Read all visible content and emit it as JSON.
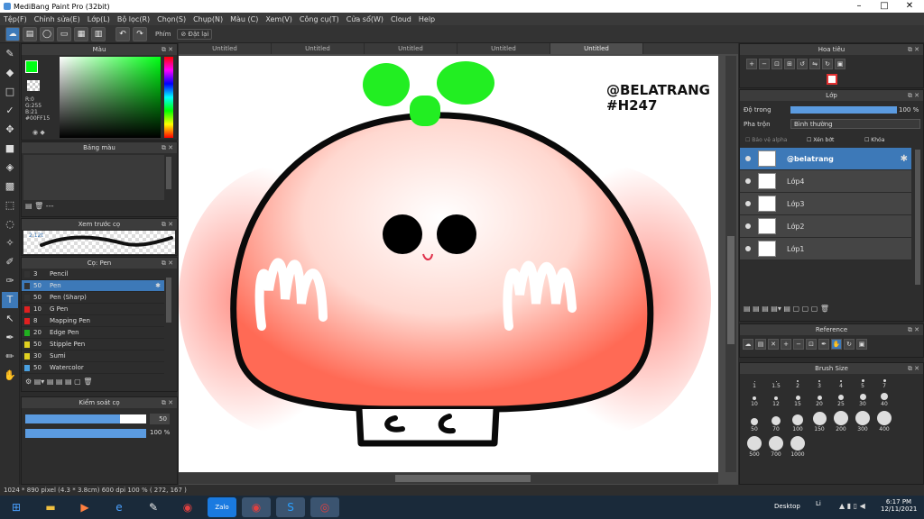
{
  "window": {
    "title": "MediBang Paint Pro (32bit)"
  },
  "menu": [
    "Tệp(F)",
    "Chỉnh sửa(E)",
    "Lớp(L)",
    "Bộ lọc(R)",
    "Chọn(S)",
    "Chụp(N)",
    "Màu (C)",
    "Xem(V)",
    "Công cụ(T)",
    "Cửa sổ(W)",
    "Cloud",
    "Help"
  ],
  "toolbar": {
    "key_label": "Phím",
    "reset_label": "Đặt lại"
  },
  "tabs": [
    "Untitled",
    "Untitled",
    "Untitled",
    "Untitled",
    "Untitled"
  ],
  "color_panel": {
    "title": "Màu",
    "r": "R:0",
    "g": "G:255",
    "b": "B:21",
    "hex": "#00FF15",
    "fg": "#00ff15"
  },
  "palette_panel": {
    "title": "Bảng màu"
  },
  "brush_preview": {
    "title": "Xem trước cọ",
    "size": "2.12t"
  },
  "brush_panel": {
    "title": "Cọ: Pen",
    "items": [
      {
        "size": "3",
        "name": "Pencil",
        "color": "#333333"
      },
      {
        "size": "50",
        "name": "Pen",
        "color": "#333333",
        "selected": true
      },
      {
        "size": "50",
        "name": "Pen (Sharp)",
        "color": "#333333"
      },
      {
        "size": "10",
        "name": "G Pen",
        "color": "#e02020"
      },
      {
        "size": "8",
        "name": "Mapping Pen",
        "color": "#e02020"
      },
      {
        "size": "20",
        "name": "Edge Pen",
        "color": "#20b020"
      },
      {
        "size": "50",
        "name": "Stipple Pen",
        "color": "#e0d020"
      },
      {
        "size": "30",
        "name": "Sumi",
        "color": "#e0d020"
      },
      {
        "size": "50",
        "name": "Watercolor",
        "color": "#4aa0e0"
      }
    ]
  },
  "brush_control": {
    "title": "Kiểm soát cọ",
    "size": "50",
    "opacity": "100 %",
    "size_level": 0.78,
    "opacity_level": 1.0
  },
  "navigator": {
    "title": "Hoa tiêu"
  },
  "layer_panel": {
    "title": "Lớp",
    "opacity_label": "Độ trong",
    "opacity": "100 %",
    "blend_label": "Pha trộn",
    "blend": "Bình thường",
    "protect_alpha": "Bảo vệ alpha",
    "clipping": "Xén bớt",
    "lock": "Khóa",
    "layers": [
      {
        "name": "@belatrang",
        "selected": true
      },
      {
        "name": "Lớp4"
      },
      {
        "name": "Lớp3"
      },
      {
        "name": "Lớp2"
      },
      {
        "name": "Lớp1"
      }
    ]
  },
  "reference": {
    "title": "Reference"
  },
  "brush_size": {
    "title": "Brush Size",
    "sizes": [
      "1",
      "1.5",
      "2",
      "3",
      "4",
      "5",
      "7",
      "10",
      "12",
      "15",
      "20",
      "25",
      "30",
      "40",
      "50",
      "70",
      "100",
      "150",
      "200",
      "300",
      "400",
      "500",
      "700",
      "1000"
    ]
  },
  "canvas": {
    "text1": "@BELATRANG",
    "text2": "#H247"
  },
  "status": {
    "text": "1024 * 890 pixel   (4.3 * 3.8cm)   600 dpi   100 %   ( 272, 167 )"
  },
  "taskbar": {
    "desktop": "Desktop",
    "lang": "Li",
    "time": "6:17 PM",
    "date": "12/11/2021"
  },
  "colors": {
    "accent": "#3d79b8",
    "mushroom_green": "#22ee22",
    "blush": "#ff5a4a"
  }
}
